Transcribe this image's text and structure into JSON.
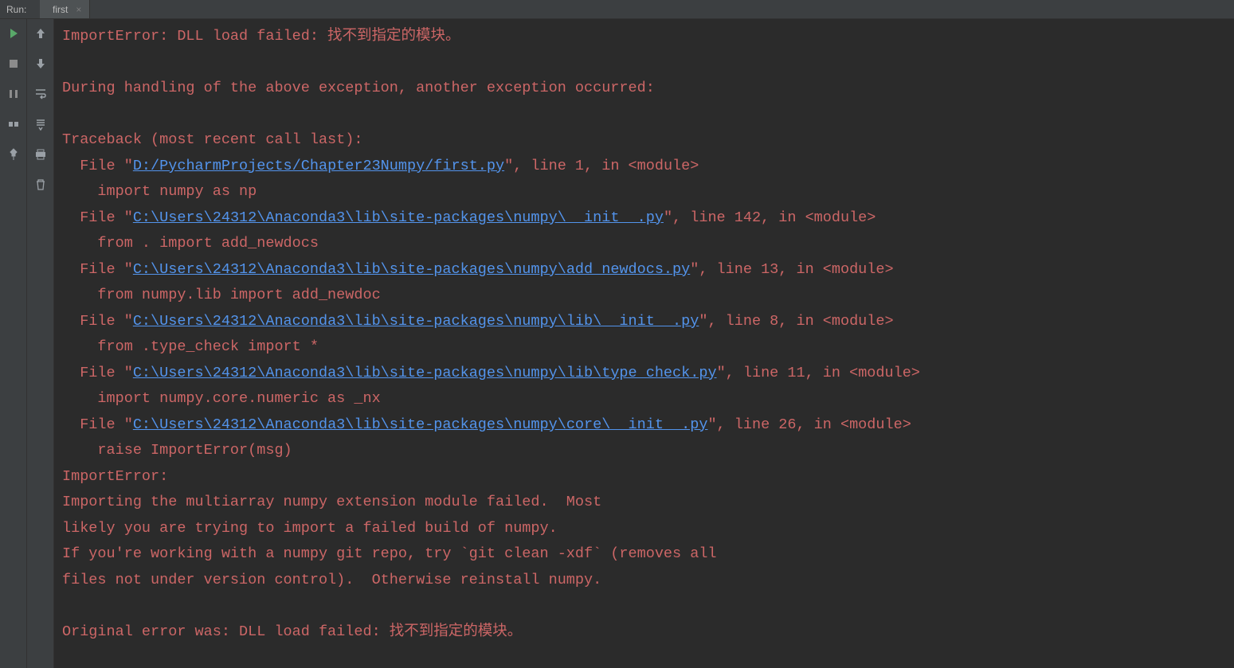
{
  "header": {
    "run_label": "Run:",
    "tab_name": "first",
    "close_glyph": "×"
  },
  "console": {
    "l1_a": "ImportError: DLL load failed: 找不到指定的模块。",
    "blank": "",
    "l2": "During handling of the above exception, another exception occurred:",
    "l3": "Traceback (most recent call last):",
    "f1_pre": "  File \"",
    "f1_link": "D:/PycharmProjects/Chapter23Numpy/first.py",
    "f1_post": "\", line 1, in <module>",
    "f1_body": "    import numpy as np",
    "f2_pre": "  File \"",
    "f2_link": "C:\\Users\\24312\\Anaconda3\\lib\\site-packages\\numpy\\__init__.py",
    "f2_post": "\", line 142, in <module>",
    "f2_body": "    from . import add_newdocs",
    "f3_pre": "  File \"",
    "f3_link": "C:\\Users\\24312\\Anaconda3\\lib\\site-packages\\numpy\\add_newdocs.py",
    "f3_post": "\", line 13, in <module>",
    "f3_body": "    from numpy.lib import add_newdoc",
    "f4_pre": "  File \"",
    "f4_link": "C:\\Users\\24312\\Anaconda3\\lib\\site-packages\\numpy\\lib\\__init__.py",
    "f4_post": "\", line 8, in <module>",
    "f4_body": "    from .type_check import *",
    "f5_pre": "  File \"",
    "f5_link": "C:\\Users\\24312\\Anaconda3\\lib\\site-packages\\numpy\\lib\\type_check.py",
    "f5_post": "\", line 11, in <module>",
    "f5_body": "    import numpy.core.numeric as _nx",
    "f6_pre": "  File \"",
    "f6_link": "C:\\Users\\24312\\Anaconda3\\lib\\site-packages\\numpy\\core\\__init__.py",
    "f6_post": "\", line 26, in <module>",
    "f6_body": "    raise ImportError(msg)",
    "m1": "ImportError: ",
    "m2": "Importing the multiarray numpy extension module failed.  Most",
    "m3": "likely you are trying to import a failed build of numpy.",
    "m4": "If you're working with a numpy git repo, try `git clean -xdf` (removes all",
    "m5": "files not under version control).  Otherwise reinstall numpy.",
    "m6": "Original error was: DLL load failed: 找不到指定的模块。"
  }
}
